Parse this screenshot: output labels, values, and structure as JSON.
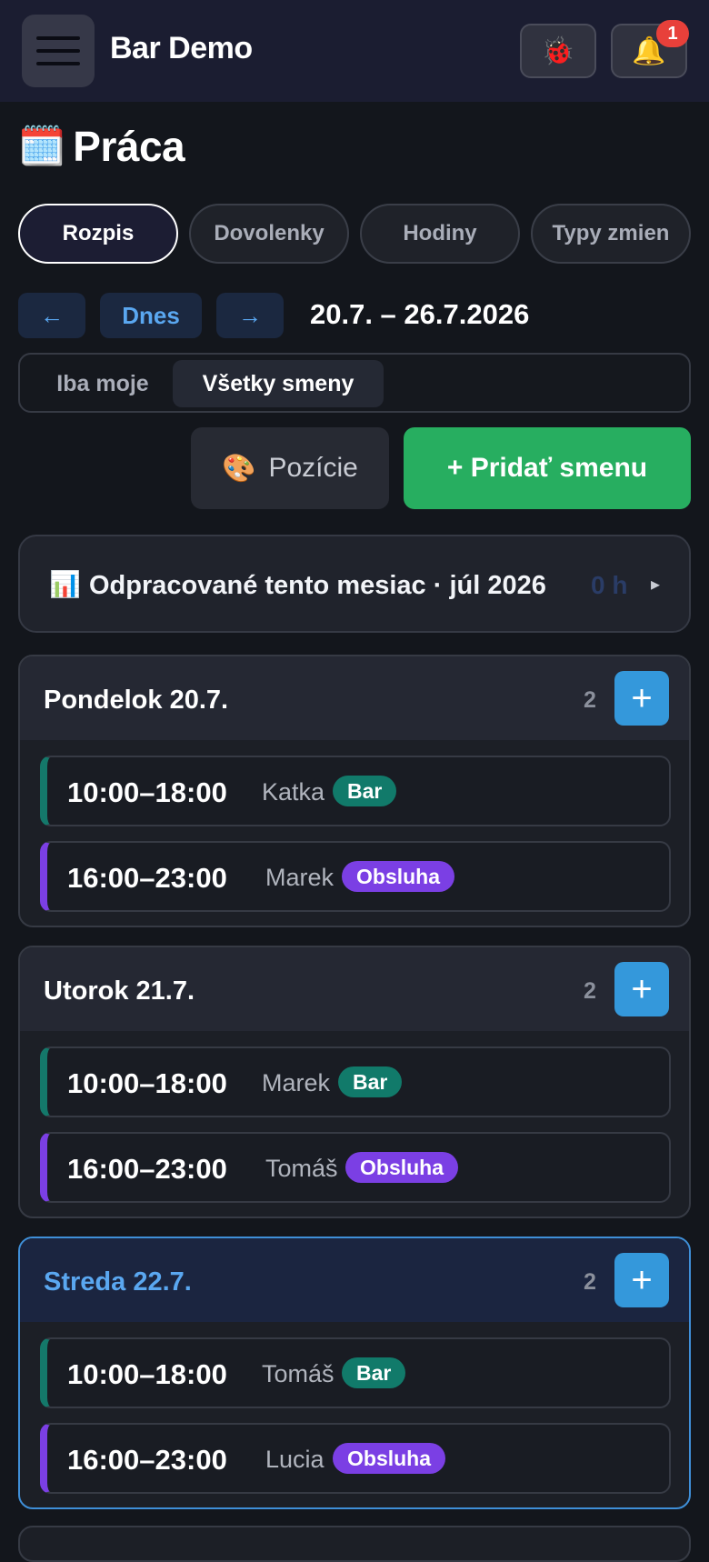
{
  "header": {
    "app_title": "Bar Demo",
    "bug_icon": "🐞",
    "bell_icon": "🔔",
    "notification_count": "1"
  },
  "page": {
    "title_icon": "🗓️",
    "title": "Práca"
  },
  "tabs": [
    {
      "label": "Rozpis",
      "active": true
    },
    {
      "label": "Dovolenky",
      "active": false
    },
    {
      "label": "Hodiny",
      "active": false
    },
    {
      "label": "Typy zmien",
      "active": false
    }
  ],
  "week_nav": {
    "prev": "←",
    "today": "Dnes",
    "next": "→",
    "range": "20.7. – 26.7.2026"
  },
  "filter": {
    "mine": "Iba moje",
    "all": "Všetky smeny",
    "selected": "all"
  },
  "actions": {
    "positions_icon": "🎨",
    "positions": "Pozície",
    "add_shift": "+ Pridať smenu"
  },
  "summary": {
    "icon": "📊",
    "label": "Odpracované tento mesiac · júl 2026",
    "value": "0 h",
    "chevron": "▸"
  },
  "days": [
    {
      "name": "Pondelok 20.7.",
      "count": "2",
      "add": "+",
      "shifts": [
        {
          "time": "10:00–18:00",
          "person": "Katka",
          "tag": "Bar"
        },
        {
          "time": "16:00–23:00",
          "person": "Marek",
          "tag": "Obsluha"
        }
      ]
    },
    {
      "name": "Utorok 21.7.",
      "count": "2",
      "add": "+",
      "shifts": [
        {
          "time": "10:00–18:00",
          "person": "Marek",
          "tag": "Bar"
        },
        {
          "time": "16:00–23:00",
          "person": "Tomáš",
          "tag": "Obsluha"
        }
      ]
    },
    {
      "name": "Streda 22.7.",
      "count": "2",
      "add": "+",
      "today": true,
      "shifts": [
        {
          "time": "10:00–18:00",
          "person": "Tomáš",
          "tag": "Bar"
        },
        {
          "time": "16:00–23:00",
          "person": "Lucia",
          "tag": "Obsluha"
        }
      ]
    }
  ],
  "colors": {
    "accent_blue": "#3498db",
    "add_green": "#27ae60",
    "tag_bar": "#117a6a",
    "tag_obsluha": "#7b3fe4",
    "badge_red": "#e8403a"
  }
}
